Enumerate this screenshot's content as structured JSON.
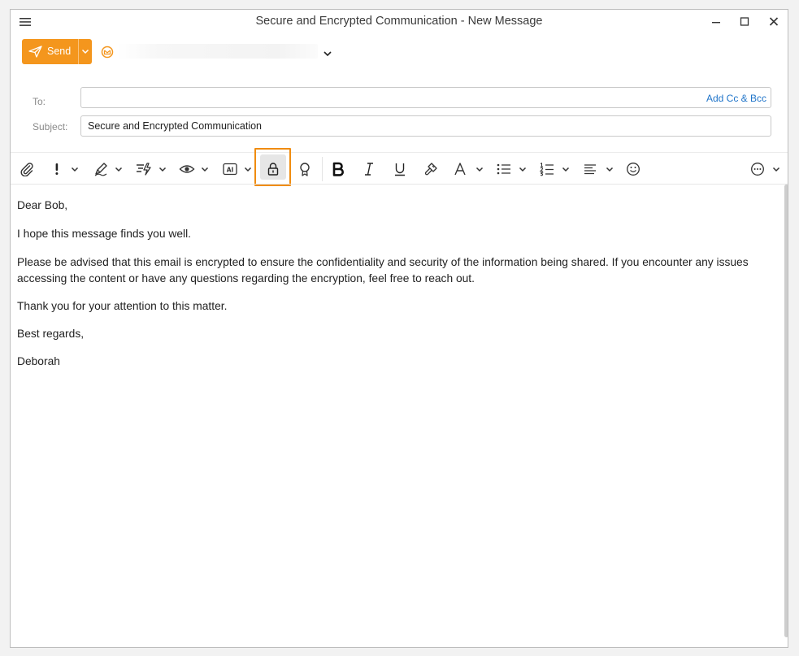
{
  "window": {
    "title": "Secure and Encrypted Communication - New Message"
  },
  "send": {
    "label": "Send"
  },
  "header": {
    "to_label": "To:",
    "to_value": "",
    "add_cc_label": "Add Cc & Bcc",
    "subject_label": "Subject:",
    "subject_value": "Secure and Encrypted Communication"
  },
  "toolbar": {
    "icons": [
      "paperclip-icon",
      "importance-icon",
      "signature-icon",
      "quick-text-icon",
      "read-receipt-icon",
      "ai-icon",
      "lock-icon",
      "certificate-icon",
      "bold-icon",
      "italic-icon",
      "underline-icon",
      "format-painter-icon",
      "font-color-icon",
      "bullet-list-icon",
      "numbered-list-icon",
      "align-icon",
      "emoji-icon",
      "more-icon"
    ],
    "highlighted": "lock-icon"
  },
  "body": {
    "paragraphs": [
      "Dear Bob,",
      "I hope this message finds you well.",
      "Please be advised that this email is encrypted to ensure the confidentiality and security of the information being shared. If you encounter any issues accessing the content or have any questions regarding the encryption, feel free to reach out.",
      "Thank you for your attention to this matter.",
      "Best regards,",
      "Deborah"
    ]
  },
  "colors": {
    "accent": "#f4961d",
    "highlight": "#f08c10",
    "link": "#1f74c9"
  }
}
